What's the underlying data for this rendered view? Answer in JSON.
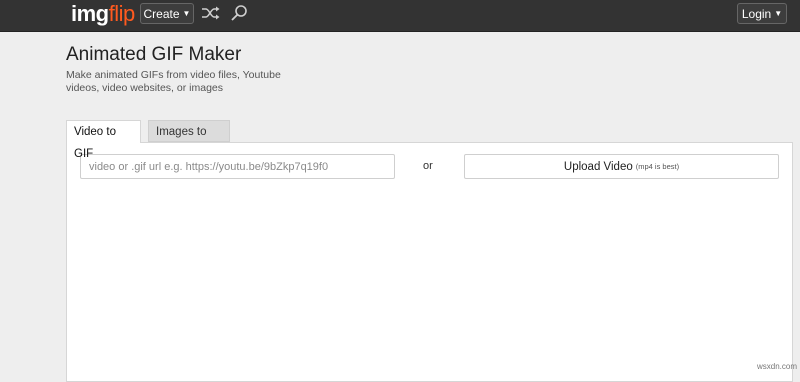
{
  "header": {
    "logo_img": "img",
    "logo_flip": "flip",
    "create_label": "Create",
    "login_label": "Login",
    "icons": [
      "shuffle-icon",
      "search-icon",
      "chevron-down-icon"
    ],
    "colors": {
      "bar": "#333333",
      "logo_accent": "#ff5a1f"
    }
  },
  "page": {
    "title": "Animated GIF Maker",
    "description": "Make animated GIFs from video files, Youtube videos, video websites, or images"
  },
  "tabs": [
    {
      "label": "Video to GIF",
      "active": true
    },
    {
      "label": "Images to GIF",
      "active": false
    }
  ],
  "video_form": {
    "url_placeholder": "video or .gif url e.g. https://youtu.be/9bZkp7q19f0",
    "url_value": "",
    "or_text": "or",
    "upload_label": "Upload Video",
    "upload_note": "(mp4 is best)"
  },
  "watermark": "wsxdn.com"
}
